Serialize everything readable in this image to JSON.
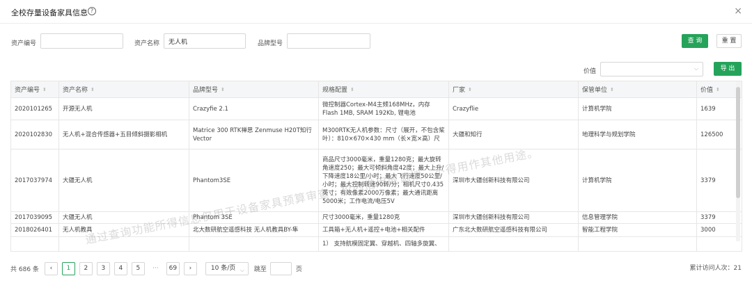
{
  "dialog": {
    "title": "全校存量设备家具信息",
    "help_icon": "?",
    "close_icon": "×"
  },
  "filters": {
    "asset_no_label": "资产编号",
    "asset_no_value": "",
    "asset_name_label": "资产名称",
    "asset_name_value": "无人机",
    "brand_label": "品牌型号",
    "brand_value": "",
    "query_button": "查 询",
    "reset_button": "重 置"
  },
  "value_filter": {
    "label": "价值",
    "selected": "",
    "chevron": "⌵"
  },
  "export_button": "导 出",
  "sort_glyph": "⬍",
  "table": {
    "columns": [
      "资产编号",
      "资产名称",
      "品牌型号",
      "规格配置",
      "厂家",
      "保管单位",
      "价值"
    ],
    "rows": [
      [
        "2020101265",
        "开源无人机",
        "Crazyfie 2.1",
        "微控制器Cortex-M4主频168MHz，内存Flash 1MB, SRAM 192Kb, 锂电池",
        "Crazyflie",
        "计算机学院",
        "1639"
      ],
      [
        "2020102830",
        "无人机+混合传感器+五目倾斜摄影相机",
        "Matrice 300 RTK禅思 Zenmuse H20T知行Vector",
        "M300RTK无人机参数：尺寸（展开，不包含桨叶）：810×670×430 mm（长×宽×高）尺",
        "大疆和知行",
        "地理科学与规划学院",
        "126500"
      ],
      [
        "2017037974",
        "大疆无人机",
        "Phantom3SE",
        "商品尺寸3000毫米，重量1280克；最大旋转角速度250；最大可倾斜角度42度；最大上升/下降速度18公里/小时；最大飞行速度50公里/小时；最大控制转速90转/分；相机尺寸0.435英寸；有效像素2000万像素；最大通讯距离5000米；工作电流/电压5V",
        "深圳市大疆创新科技有限公司",
        "计算机学院",
        "3379"
      ],
      [
        "2017039095",
        "大疆无人机",
        "Phantom 3SE",
        "尺寸3000毫米，重量1280克",
        "深圳市大疆创新科技有限公司",
        "信息管理学院",
        "3379"
      ],
      [
        "2018026401",
        "无人机教具",
        "北大数研航空遥感科技 无人机教具BY-隼",
        "工具箱+无人机+遥控+电池+相关配件",
        "广东北大数研航空遥感科技有限公司",
        "智能工程学院",
        "3000"
      ],
      [
        "",
        "",
        "",
        "1） 支持航模固定翼、穿越机、四轴多旋翼、",
        "",
        "",
        ""
      ]
    ]
  },
  "watermark": "通过查询功能所得信息仅用于设备家具预算审查、校内借用或调拨，不得用作其他用途。",
  "pagination": {
    "total": "共 686 条",
    "prev": "‹",
    "next": "›",
    "pages": [
      "1",
      "2",
      "3",
      "4",
      "5"
    ],
    "ellipsis": "···",
    "last_page": "69",
    "page_size": "10 条/页",
    "jump_label": "跳至",
    "page_unit": "页"
  },
  "visits": "累计访问人次：21",
  "colors": {
    "primary": "#25a35a",
    "header_bg": "#f5f6f7",
    "border": "#e6e6e6"
  }
}
